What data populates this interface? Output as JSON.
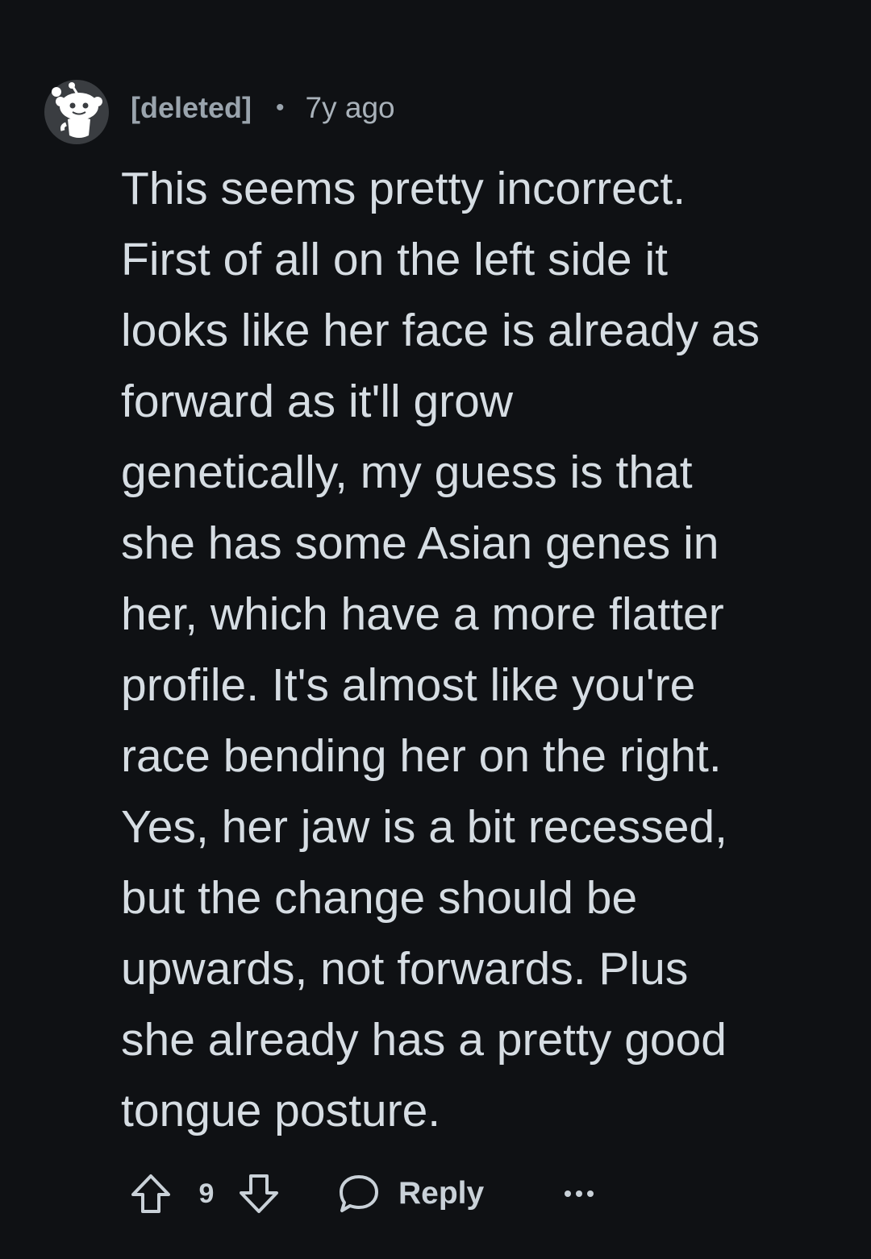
{
  "comment": {
    "author": "[deleted]",
    "separator": "•",
    "age": "7y ago",
    "body_lines": [
      "This seems pretty incorrect.",
      "First of all on the left side it",
      "looks like her face is already as",
      "forward as it'll grow",
      "genetically, my guess is that",
      "she has some Asian genes in",
      "her, which have a more flatter",
      "profile. It's almost like you're",
      "race bending her on the right.",
      "Yes, her jaw is a bit recessed,",
      "but the change should be",
      "upwards, not forwards. Plus",
      "she already has a pretty good",
      "tongue posture."
    ]
  },
  "actions": {
    "score": "9",
    "reply_label": "Reply",
    "upvote_icon": "upvote-arrow-icon",
    "downvote_icon": "downvote-arrow-icon",
    "reply_icon": "speech-bubble-icon",
    "more_icon": "ellipsis-icon"
  },
  "colors": {
    "background": "#0f1114",
    "text": "#d6dde3",
    "muted": "#9aa4ad"
  }
}
